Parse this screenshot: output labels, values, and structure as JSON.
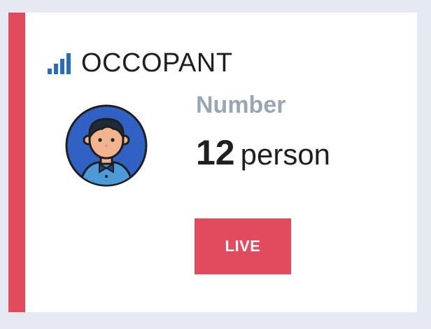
{
  "card": {
    "title": "OCCOPANT",
    "title_icon": "signal-bars-icon",
    "avatar_icon": "person-avatar-icon",
    "metric_label": "Number",
    "metric_value": "12",
    "metric_unit": "person",
    "live_button_label": "LIVE"
  },
  "colors": {
    "accent": "#e24b5d",
    "icon_blue": "#2b6cb8",
    "label_gray": "#98a7b3",
    "background": "#e6e9f2"
  }
}
